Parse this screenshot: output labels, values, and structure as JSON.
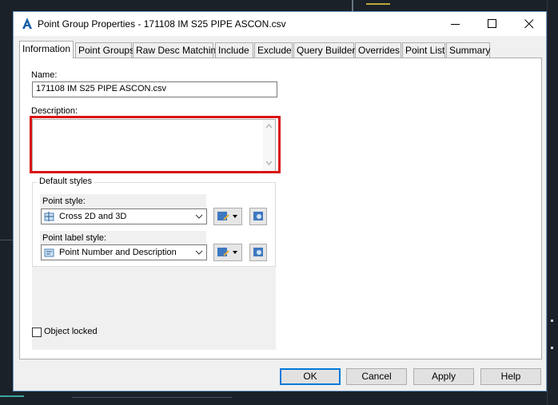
{
  "window": {
    "title": "Point Group Properties - 171108 IM S25 PIPE ASCON.csv",
    "icons": {
      "app": "autocad-a-icon",
      "minimize": "minimize-icon",
      "maximize": "maximize-icon",
      "close": "close-icon"
    }
  },
  "tabs": [
    {
      "label": "Information",
      "active": true
    },
    {
      "label": "Point Groups",
      "active": false
    },
    {
      "label": "Raw Desc Matching",
      "active": false
    },
    {
      "label": "Include",
      "active": false
    },
    {
      "label": "Exclude",
      "active": false
    },
    {
      "label": "Query Builder",
      "active": false
    },
    {
      "label": "Overrides",
      "active": false
    },
    {
      "label": "Point List",
      "active": false
    },
    {
      "label": "Summary",
      "active": false
    }
  ],
  "info": {
    "name_label": "Name:",
    "name_value": "171108 IM S25 PIPE ASCON.csv",
    "description_label": "Description:",
    "description_value": "",
    "default_styles_title": "Default styles",
    "point_style_label": "Point style:",
    "point_style_value": "Cross 2D and 3D",
    "point_label_style_label": "Point label style:",
    "point_label_style_value": "Point Number and Description",
    "object_locked_label": "Object locked",
    "object_locked_checked": false
  },
  "buttons": {
    "ok": "OK",
    "cancel": "Cancel",
    "apply": "Apply",
    "help": "Help"
  },
  "colors": {
    "highlight": "#d81313",
    "accent": "#0078d7",
    "dialog_bg": "#f0f0f0",
    "backdrop": "#1b2128"
  }
}
